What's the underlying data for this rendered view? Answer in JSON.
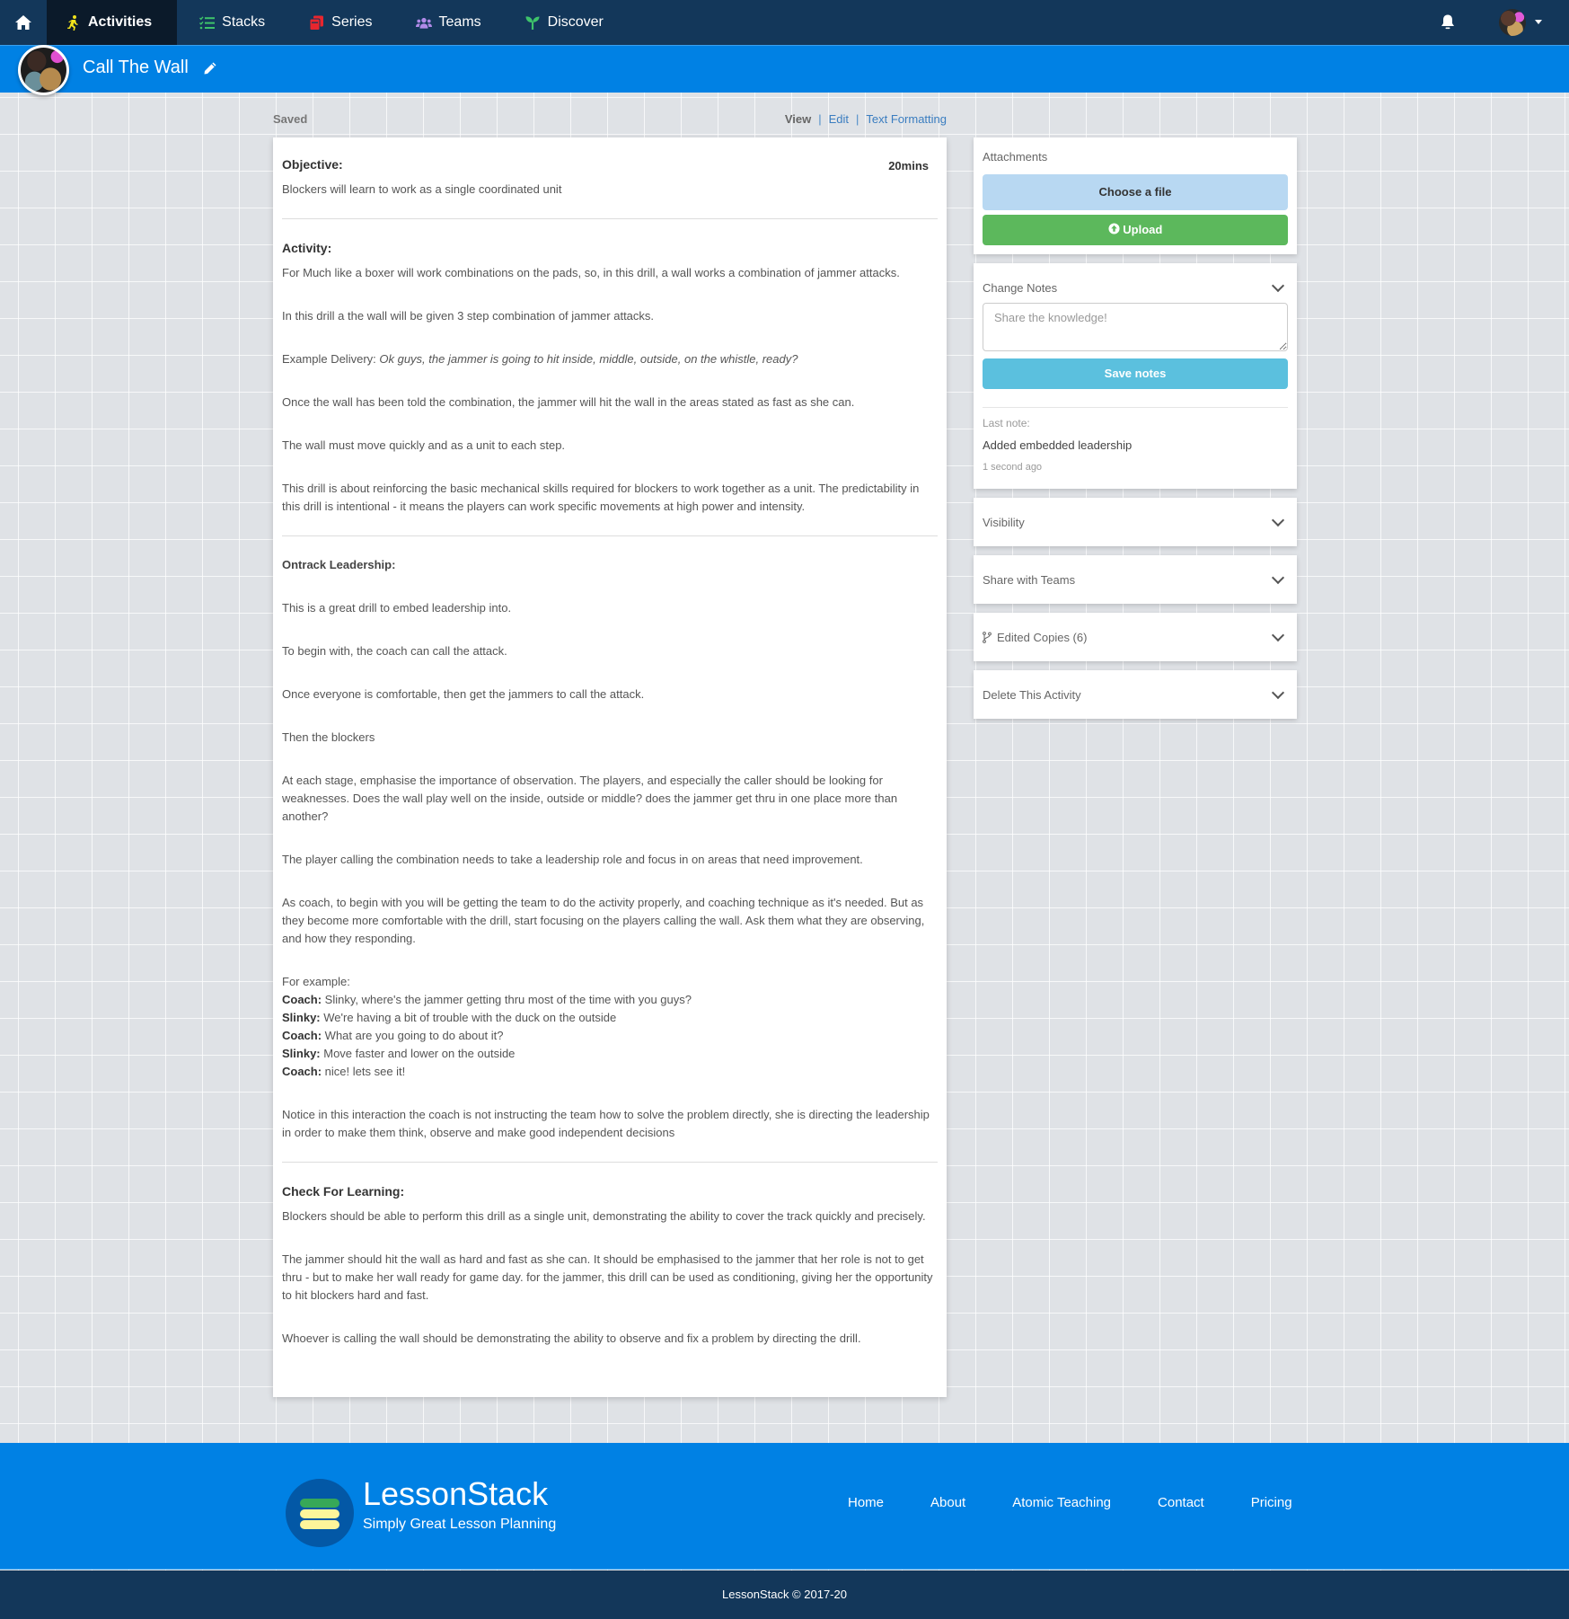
{
  "nav": {
    "home_label": "Home",
    "items": [
      {
        "label": "Activities",
        "icon": "running-person-icon",
        "icon_color": "#f1e31b",
        "active": true
      },
      {
        "label": "Stacks",
        "icon": "checklist-icon",
        "icon_color": "#3ec36a",
        "active": false
      },
      {
        "label": "Series",
        "icon": "books-icon",
        "icon_color": "#e8262e",
        "active": false
      },
      {
        "label": "Teams",
        "icon": "users-icon",
        "icon_color": "#b08ae8",
        "active": false
      },
      {
        "label": "Discover",
        "icon": "seedling-icon",
        "icon_color": "#3ec36a",
        "active": false
      }
    ]
  },
  "header": {
    "title": "Call The Wall"
  },
  "toolbar": {
    "status": "Saved",
    "view": "View",
    "edit": "Edit",
    "text_formatting": "Text Formatting",
    "separator": "|"
  },
  "activity": {
    "duration": "20mins",
    "objective": {
      "heading": "Objective:",
      "text": "Blockers will learn to work as a single coordinated unit"
    },
    "activity_section": {
      "heading": "Activity:",
      "paragraphs": [
        "For Much like a boxer will work combinations on the pads, so, in this drill, a wall works a combination of jammer attacks.",
        "In this drill a the wall will be given 3 step combination of jammer attacks.",
        "Once the wall has been told the combination, the jammer will hit the wall in the areas stated as fast as she can.",
        "The wall must move quickly and as a unit to each step.",
        "This drill is about reinforcing the basic mechanical skills required for blockers to work together as a unit. The predictability in this drill is intentional - it means the players can work specific movements at high power and intensity."
      ],
      "example_label": "Example Delivery: ",
      "example_text": "Ok guys, the jammer is going to hit inside, middle, outside, on the whistle, ready?"
    },
    "leadership": {
      "heading": "Ontrack Leadership:",
      "paragraphs": [
        "This is a great drill to embed leadership into.",
        "To begin with, the coach can call the attack.",
        "Once everyone is comfortable, then get the jammers to call the attack.",
        "Then the blockers",
        "At each stage, emphasise the importance of observation. The players, and especially the caller should be looking for weaknesses. Does the wall play well on the inside, outside or middle? does the jammer get thru in one place more than another?",
        "The player calling the combination needs to take a leadership role and focus in on areas that need improvement.",
        "As coach, to begin with you will be getting the team to do the activity properly, and coaching technique as it's needed. But as they become more comfortable with the drill, start focusing on the players calling the wall. Ask them what they are observing, and how they responding."
      ],
      "example_intro": "For example:",
      "dialogue": [
        {
          "speaker": "Coach:",
          "line": " Slinky, where's the jammer getting thru most of the time with you guys?"
        },
        {
          "speaker": "Slinky:",
          "line": " We're having a bit of trouble with the duck on the outside"
        },
        {
          "speaker": "Coach:",
          "line": " What are you going to do about it?"
        },
        {
          "speaker": "Slinky:",
          "line": " Move faster and lower on the outside"
        },
        {
          "speaker": "Coach:",
          "line": " nice! lets see it!"
        }
      ],
      "closing": "Notice in this interaction the coach is not instructing the team how to solve the problem directly, she is directing the leadership in order to make them think, observe and make good independent decisions"
    },
    "check": {
      "heading": "Check For Learning:",
      "paragraphs": [
        "Blockers should be able to perform this drill as a single unit, demonstrating the ability to cover the track quickly and precisely.",
        "The jammer should hit the wall as hard and fast as she can. It should be emphasised to the jammer that her role is not to get thru - but to make her wall ready for game day. for the jammer, this drill can be used as conditioning, giving her the opportunity to hit blockers hard and fast.",
        "Whoever is calling the wall should be demonstrating the ability to observe and fix a problem by directing the drill."
      ]
    }
  },
  "sidebar": {
    "attachments": {
      "title": "Attachments",
      "choose_label": "Choose a file",
      "upload_label": "Upload"
    },
    "change_notes": {
      "title": "Change Notes",
      "placeholder": "Share the knowledge!",
      "value": "",
      "save_label": "Save notes",
      "last_note_label": "Last note:",
      "last_note_text": "Added embedded leadership",
      "last_note_time": "1 second ago"
    },
    "panels": [
      {
        "label": "Visibility"
      },
      {
        "label": "Share with Teams"
      },
      {
        "label": "Edited Copies (6)",
        "icon": "code-branch-icon"
      },
      {
        "label": "Delete This Activity"
      }
    ]
  },
  "footer": {
    "brand": "LessonStack",
    "tagline": "Simply Great Lesson Planning",
    "links": [
      "Home",
      "About",
      "Atomic Teaching",
      "Contact",
      "Pricing"
    ],
    "copyright": "LessonStack © 2017-20"
  },
  "colors": {
    "nav_bg": "#13375a",
    "nav_active_bg": "#0b1a2a",
    "header_blue": "#0081e4",
    "upload_green": "#5cb85c",
    "save_blue": "#5bc0de",
    "choose_blue": "#b8d8f2"
  }
}
